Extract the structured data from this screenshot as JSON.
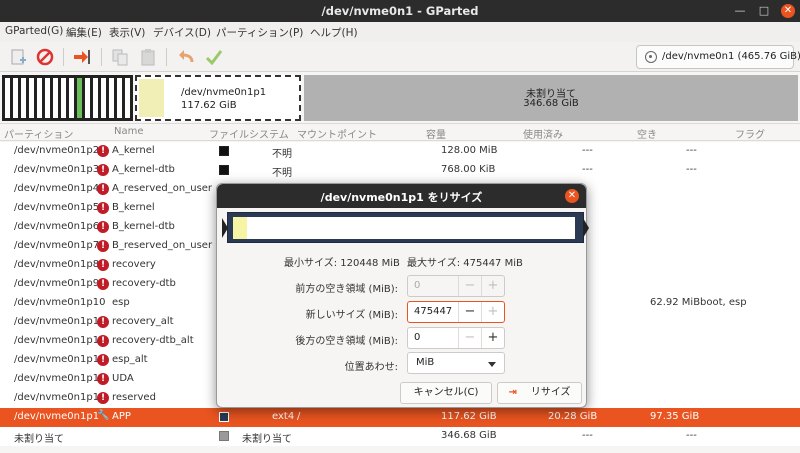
{
  "window": {
    "title": "/dev/nvme0n1 - GParted"
  },
  "menu": [
    "GParted(G)",
    "編集(E)",
    "表示(V)",
    "デバイス(D)",
    "パーティション(P)",
    "ヘルプ(H)"
  ],
  "device_selector": "/dev/nvme0n1 (465.76 GiB)",
  "disk_map": {
    "selected_partition": {
      "name": "/dev/nvme0n1p1",
      "size": "117.62 GiB"
    },
    "unallocated": {
      "label": "未割り当て",
      "size": "346.68 GiB"
    }
  },
  "columns": {
    "partition": "パーティション",
    "name": "Name",
    "filesystem": "ファイルシステム",
    "mountpoint": "マウントポイント",
    "size": "容量",
    "used": "使用済み",
    "free": "空き",
    "flags": "フラグ"
  },
  "rows": [
    {
      "partition": "/dev/nvme0n1p2",
      "name": "A_kernel",
      "fs": "不明",
      "size": "128.00 MiB",
      "used": "---",
      "free": "---",
      "flags": ""
    },
    {
      "partition": "/dev/nvme0n1p3",
      "name": "A_kernel-dtb",
      "fs": "不明",
      "size": "768.00 KiB",
      "used": "---",
      "free": "---",
      "flags": ""
    },
    {
      "partition": "/dev/nvme0n1p4",
      "name": "A_reserved_on_user",
      "fs": "",
      "size": "",
      "used": "",
      "free": "",
      "flags": ""
    },
    {
      "partition": "/dev/nvme0n1p5",
      "name": "B_kernel",
      "fs": "",
      "size": "",
      "used": "",
      "free": "",
      "flags": ""
    },
    {
      "partition": "/dev/nvme0n1p6",
      "name": "B_kernel-dtb",
      "fs": "",
      "size": "",
      "used": "",
      "free": "",
      "flags": ""
    },
    {
      "partition": "/dev/nvme0n1p7",
      "name": "B_reserved_on_user",
      "fs": "",
      "size": "",
      "used": "",
      "free": "",
      "flags": ""
    },
    {
      "partition": "/dev/nvme0n1p8",
      "name": "recovery",
      "fs": "",
      "size": "",
      "used": "",
      "free": "",
      "flags": ""
    },
    {
      "partition": "/dev/nvme0n1p9",
      "name": "recovery-dtb",
      "fs": "",
      "size": "",
      "used": "",
      "free": "",
      "flags": ""
    },
    {
      "partition": "/dev/nvme0n1p10",
      "name": "esp",
      "fs": "",
      "size": "",
      "used": "",
      "free": "62.92 MiB",
      "flags": "boot, esp"
    },
    {
      "partition": "/dev/nvme0n1p11",
      "name": "recovery_alt",
      "fs": "",
      "size": "",
      "used": "",
      "free": "",
      "flags": ""
    },
    {
      "partition": "/dev/nvme0n1p12",
      "name": "recovery-dtb_alt",
      "fs": "",
      "size": "",
      "used": "",
      "free": "",
      "flags": ""
    },
    {
      "partition": "/dev/nvme0n1p13",
      "name": "esp_alt",
      "fs": "",
      "size": "",
      "used": "",
      "free": "",
      "flags": ""
    },
    {
      "partition": "/dev/nvme0n1p14",
      "name": "UDA",
      "fs": "",
      "size": "",
      "used": "",
      "free": "",
      "flags": ""
    },
    {
      "partition": "/dev/nvme0n1p15",
      "name": "reserved",
      "fs": "",
      "size": "",
      "used": "",
      "free": "",
      "flags": ""
    },
    {
      "partition": "/dev/nvme0n1p1",
      "name": "APP",
      "fs": "ext4",
      "mount": "/",
      "size": "117.62 GiB",
      "used": "20.28 GiB",
      "free": "97.35 GiB",
      "flags": ""
    },
    {
      "partition": "未割り当て",
      "name": "",
      "fs": "未割り当て",
      "size": "346.68 GiB",
      "used": "---",
      "free": "---",
      "flags": ""
    }
  ],
  "dialog": {
    "title": "/dev/nvme0n1p1 をリサイズ",
    "min_size": "最小サイズ: 120448 MiB",
    "max_size": "最大サイズ: 475447 MiB",
    "free_before_label": "前方の空き領域 (MiB):",
    "free_before_value": "0",
    "new_size_label": "新しいサイズ (MiB):",
    "new_size_value": "475447",
    "free_after_label": "後方の空き領域 (MiB):",
    "free_after_value": "0",
    "align_label": "位置あわせ:",
    "align_value": "MiB",
    "cancel": "キャンセル(C)",
    "resize": "リサイズ"
  },
  "colors": {
    "accent": "#e95420",
    "ext4": "#2a3a55",
    "unallocated": "#b1b1b1",
    "warning": "#c01c28"
  }
}
